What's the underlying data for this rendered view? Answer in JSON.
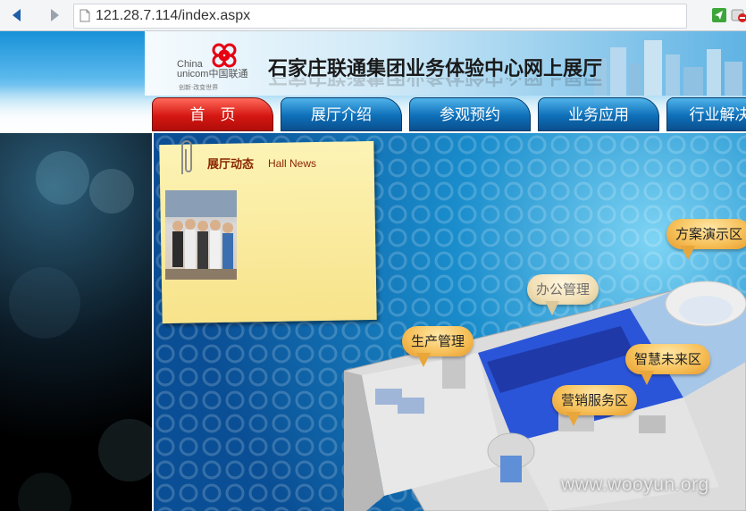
{
  "browser": {
    "url": "121.28.7.114/index.aspx"
  },
  "header": {
    "logo_cn": "China\nunicom中国联通",
    "logo_slogan": "创新·改变世界",
    "title": "石家庄联通集团业务体验中心网上展厅"
  },
  "nav": {
    "tabs": [
      {
        "label": "首　页",
        "active": true
      },
      {
        "label": "展厅介绍",
        "active": false
      },
      {
        "label": "参观预约",
        "active": false
      },
      {
        "label": "业务应用",
        "active": false
      },
      {
        "label": "行业解决方",
        "active": false
      }
    ]
  },
  "news": {
    "title": "展厅动态",
    "subtitle": "Hall News"
  },
  "zones": {
    "scheme": "方案演示区",
    "office": "办公管理",
    "production": "生产管理",
    "future": "智慧未来区",
    "marketing": "营销服务区"
  },
  "watermark": "www.wooyun.org",
  "colors": {
    "active_tab": "#d51712",
    "tab": "#0e6fb8",
    "bubble": "#f7c25c"
  }
}
